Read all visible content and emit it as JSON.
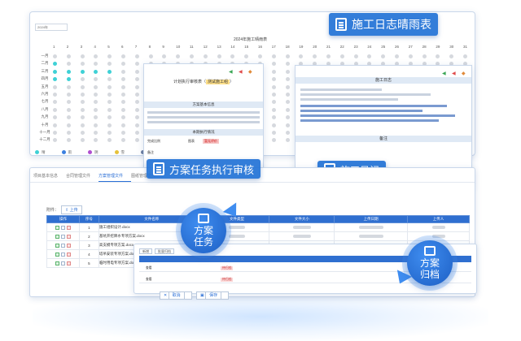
{
  "calendar": {
    "year_select": "2024年",
    "title": "2024年施工晴雨表",
    "days": [
      "1",
      "2",
      "3",
      "4",
      "5",
      "6",
      "7",
      "8",
      "9",
      "10",
      "11",
      "12",
      "13",
      "14",
      "15",
      "16",
      "17",
      "18",
      "19",
      "20",
      "21",
      "22",
      "23",
      "24",
      "25",
      "26",
      "27",
      "28",
      "29",
      "30",
      "31"
    ],
    "months": [
      "一月",
      "二月",
      "三月",
      "四月",
      "五月",
      "六月",
      "七月",
      "八月",
      "九月",
      "十月",
      "十一月",
      "十二月"
    ],
    "legend": [
      {
        "label": "晴",
        "color": "#3fd1d6"
      },
      {
        "label": "雨",
        "color": "#3b7fe0"
      },
      {
        "label": "阴",
        "color": "#b04fd0"
      },
      {
        "label": "雪",
        "color": "#e6c23a"
      },
      {
        "label": "雾",
        "color": "#6d7ea0"
      }
    ]
  },
  "badges": {
    "weather": "施工日志晴雨表",
    "review": "方案任务执行审核",
    "daily": "施工日记",
    "task_line1": "方案",
    "task_line2": "任务",
    "archive_line1": "方案",
    "archive_line2": "归档"
  },
  "review": {
    "title_prefix": "计划执行审核表（",
    "title_highlight": "测试施工组",
    "title_suffix": "）",
    "section1": "方案基本信息",
    "section2": "本期执行情况",
    "row1_label": "完成比例",
    "row1_mid": "图表",
    "row1_tag": "暂无评价",
    "row2_label": "备注",
    "row3_label": "工程管理部技术主管意见",
    "sign_label": "签字："
  },
  "daily": {
    "title": "施工日志",
    "remark": "备注"
  },
  "files": {
    "tabs": [
      "项目基本信息",
      "合同管理文件",
      "方案管理文件",
      "图纸管理文件"
    ],
    "upload_label": "附件：",
    "upload_button": "上传",
    "columns": [
      "操作",
      "序号",
      "文件名称",
      "文件类型",
      "文件大小",
      "上传日期",
      "上传人"
    ],
    "rows": [
      {
        "no": "1",
        "name": "施工组织设计.docx"
      },
      {
        "no": "2",
        "name": "基坑开挖降水专项方案.docx"
      },
      {
        "no": "3",
        "name": "高支模专项方案.docx"
      },
      {
        "no": "4",
        "name": "塔吊安装专项方案.docx"
      },
      {
        "no": "5",
        "name": "临时用电专项方案.docx"
      }
    ]
  },
  "archive": {
    "tools": [
      "新增",
      "批量归档"
    ],
    "rows": [
      {
        "op": "查看",
        "tag": "待归档"
      },
      {
        "op": "查看",
        "tag": "待归档"
      }
    ],
    "cancel": "取消",
    "save": "保存"
  }
}
